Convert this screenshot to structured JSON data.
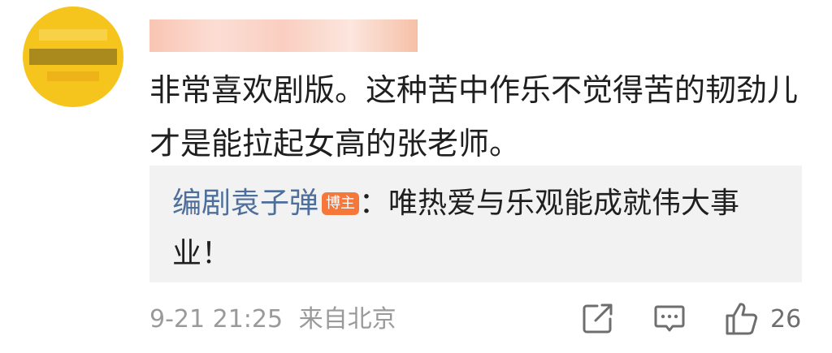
{
  "comment": {
    "username": "",
    "content": "非常喜欢剧版。这种苦中作乐不觉得苦的韧劲儿才是能拉起女高的张老师。"
  },
  "reply": {
    "author": "编剧袁子弹",
    "badge": "博主",
    "separator": "：",
    "text": "唯热爱与乐观能成就伟大事业！"
  },
  "meta": {
    "timestamp": "9-21 21:25",
    "location": "来自北京"
  },
  "actions": {
    "share_icon": "share-icon",
    "comment_icon": "comment-icon",
    "like_icon": "thumbs-up-icon",
    "like_count": "26"
  },
  "colors": {
    "author_link": "#4e6f9c",
    "badge": "#f5773a",
    "meta_text": "#9a9a9a",
    "reply_background": "#f2f2f2"
  }
}
